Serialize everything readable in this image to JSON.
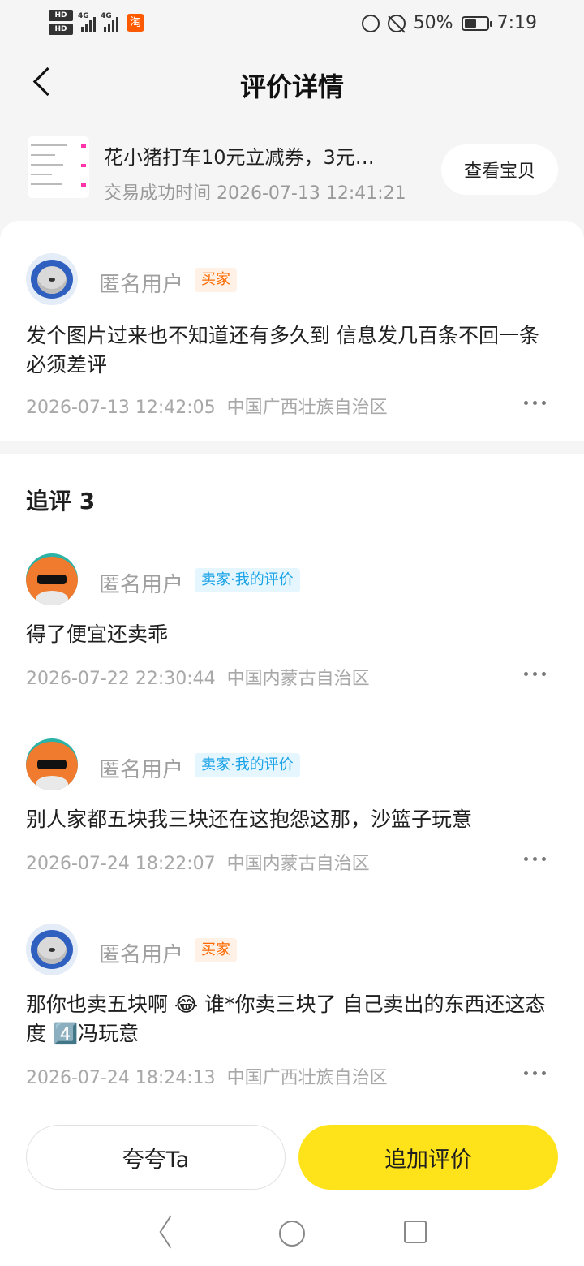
{
  "status_bar": {
    "hd1": "HD",
    "hd2": "HD",
    "net1": "4G",
    "net2": "4G",
    "taobao_icon": "淘",
    "battery": "50%",
    "time": "7:19"
  },
  "header": {
    "title": "评价详情"
  },
  "product": {
    "title": "花小猪打车10元立减券，3元…",
    "time": "交易成功时间 2026-07-13 12:41:21",
    "view_button": "查看宝贝"
  },
  "review": {
    "username": "匿名用户",
    "tag": "买家",
    "content": "发个图片过来也不知道还有多久到 信息发几百条不回一条 必须差评",
    "time": "2026-07-13 12:42:05",
    "location": "中国广西壮族自治区"
  },
  "followups_title": "追评 3",
  "followups": [
    {
      "username": "匿名用户",
      "tag": "卖家·我的评价",
      "content": "得了便宜还卖乖",
      "time": "2026-07-22 22:30:44",
      "location": "中国内蒙古自治区"
    },
    {
      "username": "匿名用户",
      "tag": "卖家·我的评价",
      "content": "别人家都五块我三块还在这抱怨这那，沙篮子玩意",
      "time": "2026-07-24 18:22:07",
      "location": "中国内蒙古自治区"
    },
    {
      "username": "匿名用户",
      "tag": "买家",
      "content": "那你也卖五块啊 😂 谁*你卖三块了 自己卖出的东西还这态度 4️⃣冯玩意",
      "time": "2026-07-24 18:24:13",
      "location": "中国广西壮族自治区"
    }
  ],
  "bottom": {
    "praise_button": "夸夸Ta",
    "add_button": "追加评价"
  }
}
